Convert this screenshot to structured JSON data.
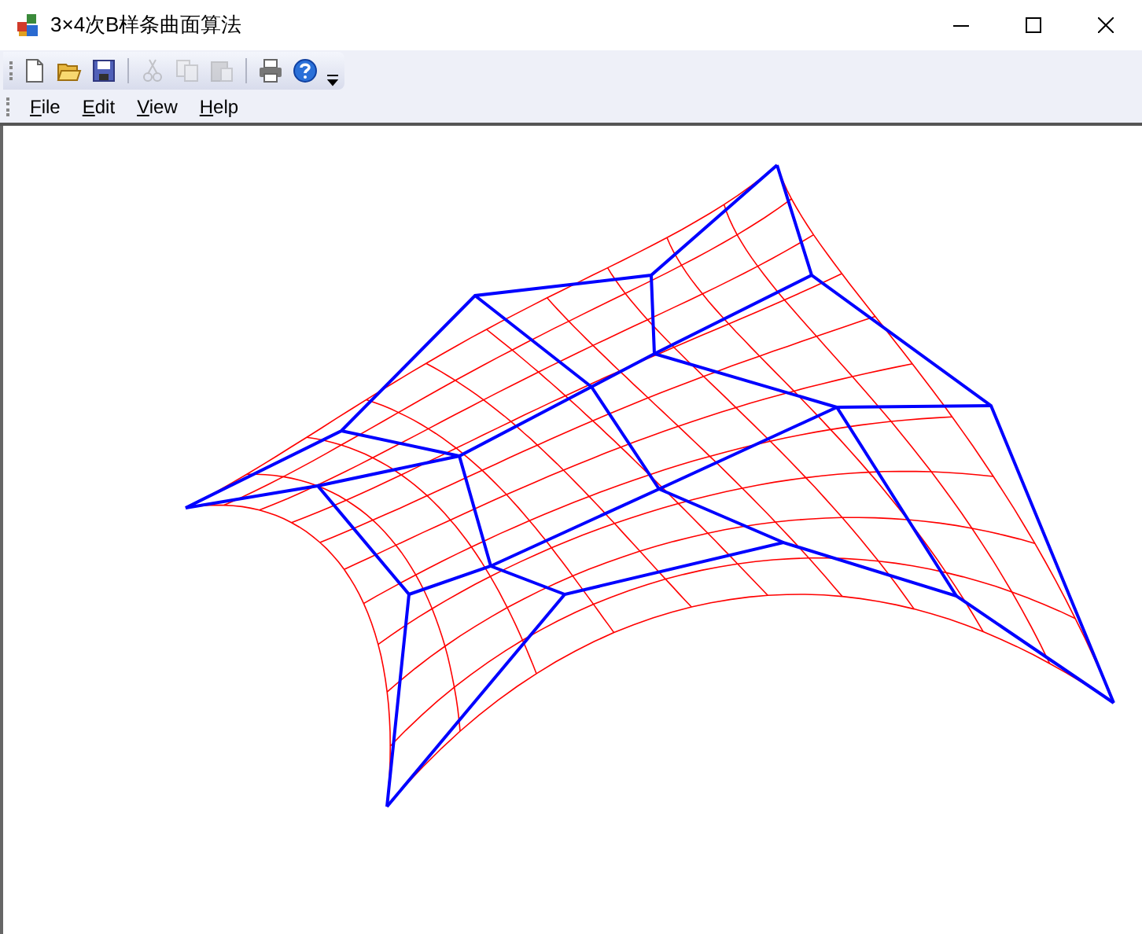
{
  "window": {
    "title": "3×4次B样条曲面算法"
  },
  "toolbar": [
    {
      "kind": "new",
      "disabled": false
    },
    {
      "kind": "open",
      "disabled": false
    },
    {
      "kind": "save",
      "disabled": false
    },
    {
      "kind": "separator"
    },
    {
      "kind": "cut",
      "disabled": true
    },
    {
      "kind": "copy",
      "disabled": true
    },
    {
      "kind": "paste",
      "disabled": true
    },
    {
      "kind": "separator"
    },
    {
      "kind": "print",
      "disabled": false
    },
    {
      "kind": "help",
      "disabled": false
    }
  ],
  "menu": [
    {
      "label": "File"
    },
    {
      "label": "Edit"
    },
    {
      "label": "View"
    },
    {
      "label": "Help"
    }
  ]
}
